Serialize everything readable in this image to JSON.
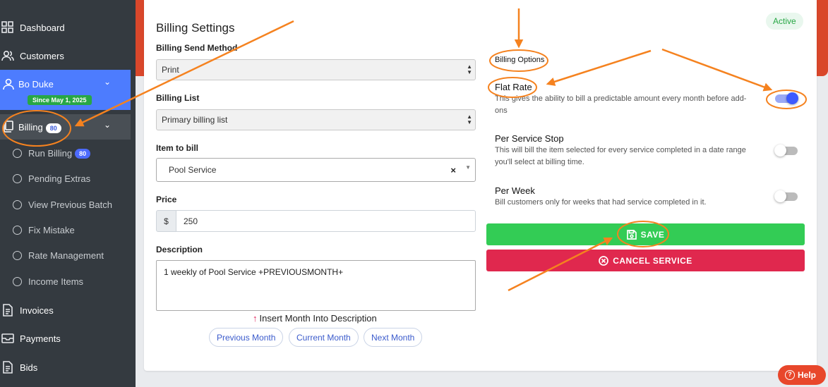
{
  "sidebar": {
    "items": [
      {
        "label": "Dashboard",
        "icon": "grid-icon"
      },
      {
        "label": "Customers",
        "icon": "users-icon"
      }
    ],
    "user": {
      "name": "Bo Duke",
      "since": "Since May 1, 2025"
    },
    "billing": {
      "label": "Billing",
      "count": "80"
    },
    "sub_items": [
      {
        "label": "Run Billing",
        "count": "80"
      },
      {
        "label": "Pending Extras"
      },
      {
        "label": "View Previous Batch"
      },
      {
        "label": "Fix Mistake"
      },
      {
        "label": "Rate Management"
      },
      {
        "label": "Income Items"
      }
    ],
    "bottom_items": [
      {
        "label": "Invoices",
        "icon": "document-icon"
      },
      {
        "label": "Payments",
        "icon": "inbox-icon"
      },
      {
        "label": "Bids",
        "icon": "document-icon"
      }
    ]
  },
  "form": {
    "title": "Billing Settings",
    "send_method": {
      "label": "Billing Send Method",
      "value": "Print"
    },
    "billing_list": {
      "label": "Billing List",
      "value": "Primary billing list"
    },
    "item": {
      "label": "Item to bill",
      "value": "Pool Service",
      "clear": "×"
    },
    "price": {
      "label": "Price",
      "prefix": "$",
      "value": "250"
    },
    "description": {
      "label": "Description",
      "value": "1 weekly of Pool Service +PREVIOUSMONTH+"
    },
    "insert_note": "Insert Month Into Description",
    "month_buttons": [
      "Previous Month",
      "Current Month",
      "Next Month"
    ]
  },
  "options": {
    "status": "Active",
    "heading": "Billing Options",
    "list": [
      {
        "title": "Flat Rate",
        "desc": "This gives the ability to bill a predictable amount every month before add-ons",
        "on": true
      },
      {
        "title": "Per Service Stop",
        "desc": "This will bill the item selected for every service completed in a date range you'll select at billing time.",
        "on": false
      },
      {
        "title": "Per Week",
        "desc": "Bill customers only for weeks that had service completed in it.",
        "on": false
      }
    ],
    "save_label": "SAVE",
    "cancel_label": "CANCEL SERVICE"
  },
  "help": {
    "label": "Help"
  },
  "colors": {
    "accent": "#4d7cfe",
    "annotation": "#f5821f",
    "save": "#33cc55",
    "cancel": "#e0284e"
  }
}
